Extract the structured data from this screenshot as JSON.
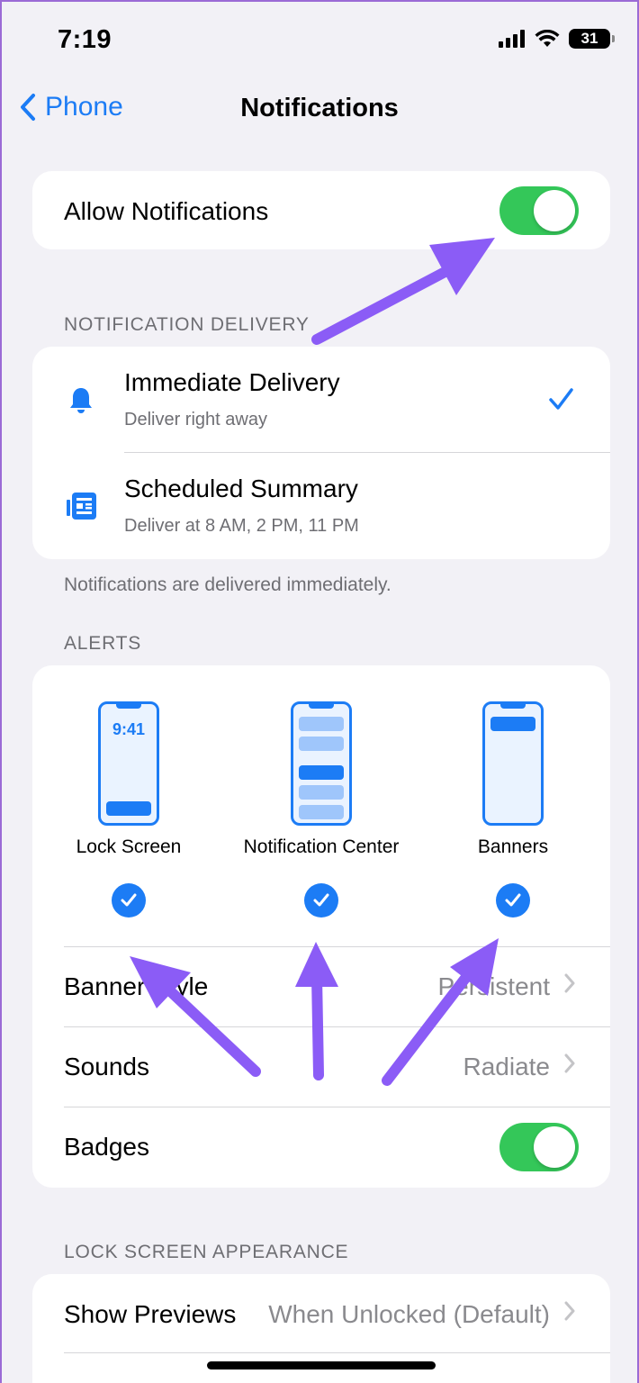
{
  "status_bar": {
    "time": "7:19",
    "battery": "31"
  },
  "nav": {
    "back_label": "Phone",
    "title": "Notifications"
  },
  "allow_notifications": {
    "label": "Allow Notifications",
    "enabled": true
  },
  "delivery": {
    "header": "NOTIFICATION DELIVERY",
    "options": [
      {
        "label": "Immediate Delivery",
        "sub": "Deliver right away",
        "icon": "bell-icon",
        "selected": true
      },
      {
        "label": "Scheduled Summary",
        "sub": "Deliver at 8 AM, 2 PM, 11 PM",
        "icon": "summary-icon",
        "selected": false
      }
    ],
    "footnote": "Notifications are delivered immediately."
  },
  "alerts": {
    "header": "ALERTS",
    "styles": [
      {
        "label": "Lock Screen",
        "phone_time": "9:41",
        "checked": true
      },
      {
        "label": "Notification Center",
        "checked": true
      },
      {
        "label": "Banners",
        "checked": true
      }
    ],
    "rows": [
      {
        "label": "Banner Style",
        "value": "Persistent"
      },
      {
        "label": "Sounds",
        "value": "Radiate"
      }
    ],
    "badges": {
      "label": "Badges",
      "enabled": true
    }
  },
  "lock_screen": {
    "header": "LOCK SCREEN APPEARANCE",
    "show_previews": {
      "label": "Show Previews",
      "value": "When Unlocked (Default)"
    }
  },
  "colors": {
    "accent": "#1c7cf5",
    "toggle_on": "#34c759",
    "annotation_arrow": "#8b5cf6"
  }
}
